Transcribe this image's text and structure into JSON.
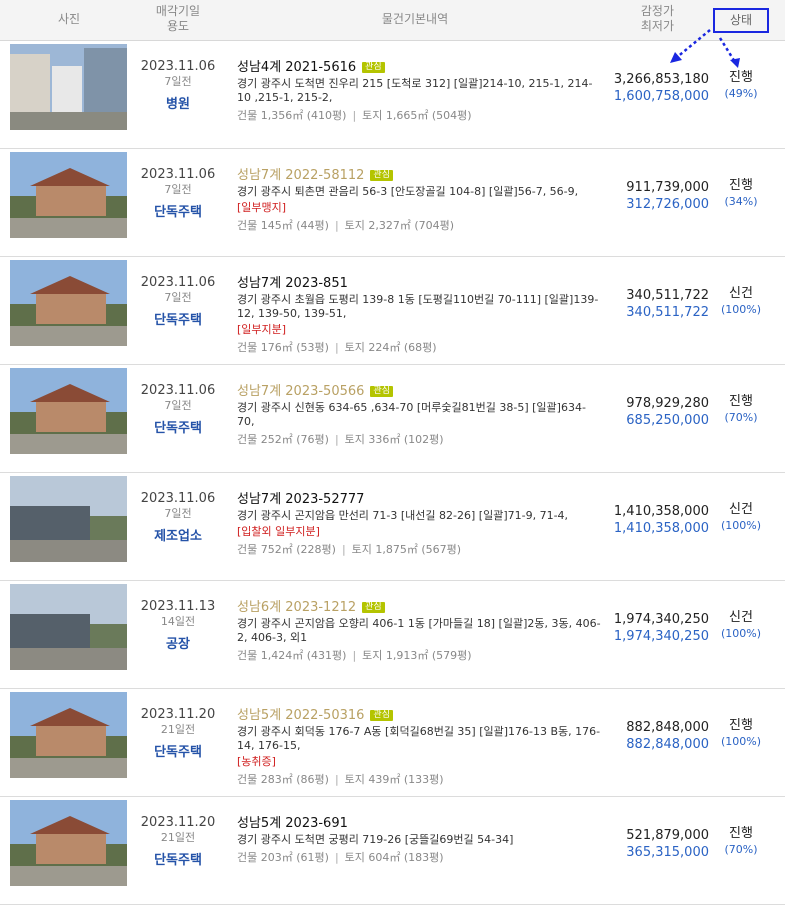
{
  "header": {
    "photo": "사진",
    "date_line1": "매각기일",
    "date_line2": "용도",
    "basic": "물건기본내역",
    "price_line1": "감정가",
    "price_line2": "최저가",
    "status": "상태"
  },
  "badge_label": "관심",
  "area_sep": "|",
  "colors": {
    "accent_blue": "#2b63c4",
    "gold": "#b9a164",
    "warn_red": "#d02020",
    "annotation": "#1a27e0"
  },
  "rows": [
    {
      "photo_icon": "building-photo",
      "date": "2023.11.06",
      "ago": "7일전",
      "use": "병원",
      "case": "성남4계 2021-5616",
      "gold": false,
      "badge": true,
      "addr": "경기 광주시 도척면 진우리 215 [도척로 312] [일괄]214-10, 215-1, 214-10 ,215-1, 215-2,",
      "warn": "",
      "building": "건물 1,356㎡ (410평)",
      "land": "토지 1,665㎡ (504평)",
      "appraisal": "3,266,853,180",
      "minimum": "1,600,758,000",
      "status": "진행",
      "percent": "(49%)"
    },
    {
      "photo_icon": "house-photo",
      "date": "2023.11.06",
      "ago": "7일전",
      "use": "단독주택",
      "case": "성남7계 2022-58112",
      "gold": true,
      "badge": true,
      "addr": "경기 광주시 퇴촌면 관음리 56-3 [안도장골길 104-8] [일괄]56-7, 56-9,",
      "warn": "[일부맹지]",
      "building": "건물 145㎡ (44평)",
      "land": "토지 2,327㎡ (704평)",
      "appraisal": "911,739,000",
      "minimum": "312,726,000",
      "status": "진행",
      "percent": "(34%)"
    },
    {
      "photo_icon": "house-photo",
      "date": "2023.11.06",
      "ago": "7일전",
      "use": "단독주택",
      "case": "성남7계 2023-851",
      "gold": false,
      "badge": false,
      "addr": "경기 광주시 초월읍 도평리 139-8 1동 [도평길110번길 70-111] [일괄]139-12, 139-50, 139-51,",
      "warn": "[일부지분]",
      "building": "건물 176㎡ (53평)",
      "land": "토지 224㎡ (68평)",
      "appraisal": "340,511,722",
      "minimum": "340,511,722",
      "status": "신건",
      "percent": "(100%)"
    },
    {
      "photo_icon": "house-photo",
      "date": "2023.11.06",
      "ago": "7일전",
      "use": "단독주택",
      "case": "성남7계 2023-50566",
      "gold": true,
      "badge": true,
      "addr": "경기 광주시 신현동 634-65 ,634-70 [머루숯길81번길 38-5] [일괄]634-70,",
      "warn": "",
      "building": "건물 252㎡ (76평)",
      "land": "토지 336㎡ (102평)",
      "appraisal": "978,929,280",
      "minimum": "685,250,000",
      "status": "진행",
      "percent": "(70%)"
    },
    {
      "photo_icon": "factory-photo",
      "date": "2023.11.06",
      "ago": "7일전",
      "use": "제조업소",
      "case": "성남7계 2023-52777",
      "gold": false,
      "badge": false,
      "addr": "경기 광주시 곤지암읍 만선리 71-3 [내선길 82-26] [일괄]71-9, 71-4,",
      "warn": "[입찰외 일부지분]",
      "building": "건물 752㎡ (228평)",
      "land": "토지 1,875㎡ (567평)",
      "appraisal": "1,410,358,000",
      "minimum": "1,410,358,000",
      "status": "신건",
      "percent": "(100%)"
    },
    {
      "photo_icon": "factory-photo",
      "date": "2023.11.13",
      "ago": "14일전",
      "use": "공장",
      "case": "성남6계 2023-1212",
      "gold": true,
      "badge": true,
      "addr": "경기 광주시 곤지암읍 오향리 406-1 1동 [가마들길 18] [일괄]2동, 3동, 406-2, 406-3, 외1",
      "warn": "",
      "building": "건물 1,424㎡ (431평)",
      "land": "토지 1,913㎡ (579평)",
      "appraisal": "1,974,340,250",
      "minimum": "1,974,340,250",
      "status": "신건",
      "percent": "(100%)"
    },
    {
      "photo_icon": "house-photo",
      "date": "2023.11.20",
      "ago": "21일전",
      "use": "단독주택",
      "case": "성남5계 2022-50316",
      "gold": true,
      "badge": true,
      "addr": "경기 광주시 회덕동 176-7 A동 [회덕길68번길 35] [일괄]176-13 B동, 176-14, 176-15,",
      "warn": "[농취증]",
      "building": "건물 283㎡ (86평)",
      "land": "토지 439㎡ (133평)",
      "appraisal": "882,848,000",
      "minimum": "882,848,000",
      "status": "진행",
      "percent": "(100%)"
    },
    {
      "photo_icon": "house-photo",
      "date": "2023.11.20",
      "ago": "21일전",
      "use": "단독주택",
      "case": "성남5계 2023-691",
      "gold": false,
      "badge": false,
      "addr": "경기 광주시 도척면 궁평리 719-26 [궁뜰길69번길 54-34]",
      "warn": "",
      "building": "건물 203㎡ (61평)",
      "land": "토지 604㎡ (183평)",
      "appraisal": "521,879,000",
      "minimum": "365,315,000",
      "status": "진행",
      "percent": "(70%)"
    }
  ]
}
